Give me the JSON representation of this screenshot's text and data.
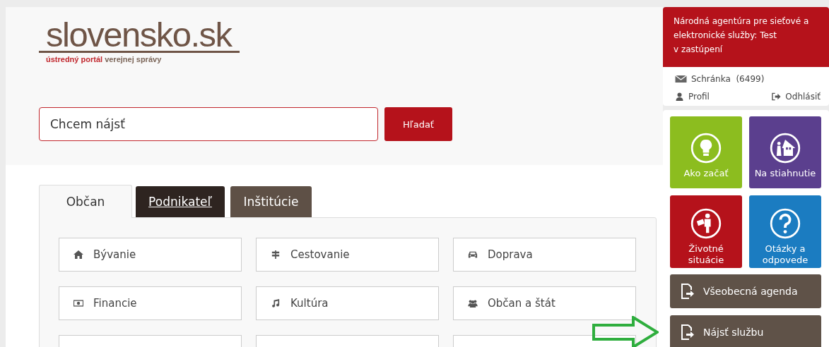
{
  "logo": {
    "name": "slovensko",
    "domain": ".sk",
    "tagline_accent": "ústredný portál",
    "tagline": "verejnej správy"
  },
  "search": {
    "placeholder": "Chcem nájsť",
    "button": "Hľadať"
  },
  "tabs": [
    {
      "label": "Občan",
      "selected": true
    },
    {
      "label": "Podnikateľ",
      "selected": false
    },
    {
      "label": "Inštitúcie",
      "selected": false
    }
  ],
  "cards": [
    {
      "kind": "full",
      "label": "Bývanie"
    },
    {
      "kind": "full",
      "label": "Cestovanie"
    },
    {
      "kind": "full",
      "label": "Doprava"
    },
    {
      "kind": "full",
      "label": "Financie"
    },
    {
      "kind": "full",
      "label": "Kultúra"
    },
    {
      "kind": "full",
      "label": "Občan a štát"
    },
    {
      "kind": "cut"
    },
    {
      "kind": "cut"
    },
    {
      "kind": "cut"
    }
  ],
  "user": {
    "name": "Národná agentúra pre sieťové a elektronické služby: Test",
    "role": "v zastúpení",
    "inbox": "Schránka",
    "inbox_count": "(6499)",
    "profile": "Profil",
    "logout": "Odhlásiť"
  },
  "tiles": [
    {
      "label": "Ako začať",
      "color": "#8cbd1f"
    },
    {
      "label": "Na stiahnutie",
      "color": "#5b3f8e"
    },
    {
      "label": "Životné situácie",
      "color": "#b5121b"
    },
    {
      "label": "Otázky a odpovede",
      "color": "#1b7cc1"
    }
  ],
  "actions": [
    "Všeobecná agenda",
    "Nájsť službu"
  ]
}
